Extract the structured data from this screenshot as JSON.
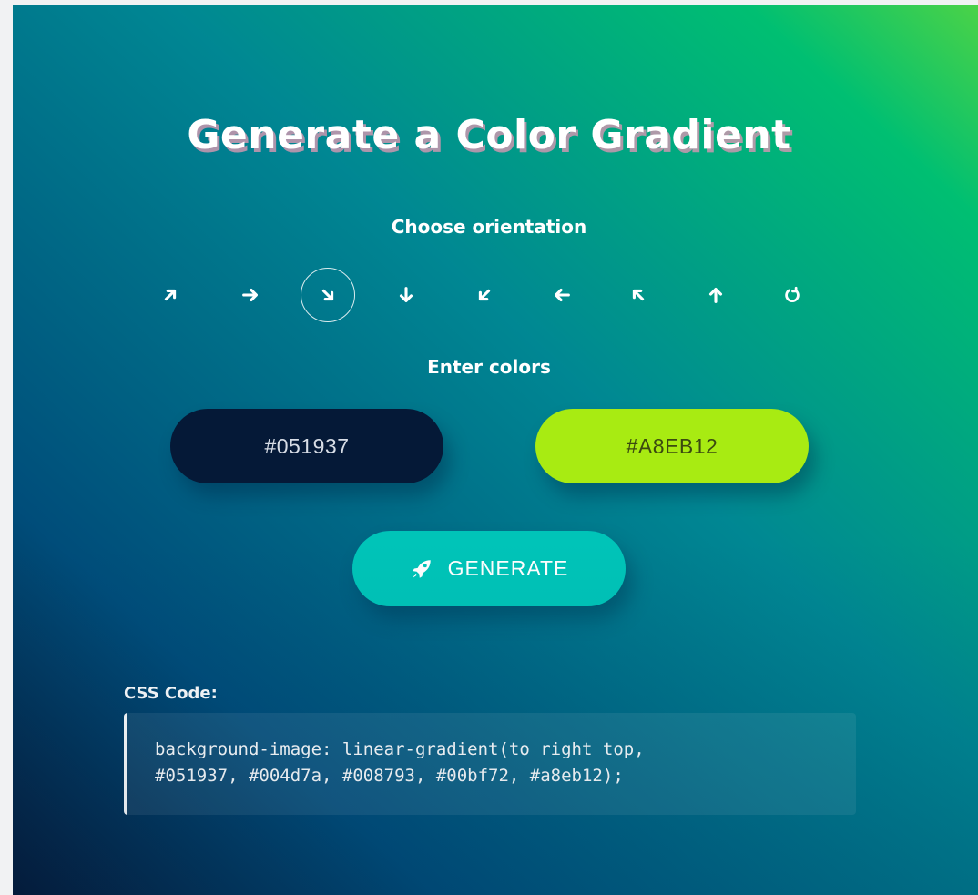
{
  "title": "Generate a Color Gradient",
  "orientation": {
    "label": "Choose orientation",
    "selected": "to-bottom-right",
    "options": [
      {
        "name": "to-top-right",
        "icon": "arrow-up-right-icon"
      },
      {
        "name": "to-right",
        "icon": "arrow-right-icon"
      },
      {
        "name": "to-bottom-right",
        "icon": "arrow-down-right-icon"
      },
      {
        "name": "to-bottom",
        "icon": "arrow-down-icon"
      },
      {
        "name": "to-bottom-left",
        "icon": "arrow-down-left-icon"
      },
      {
        "name": "to-left",
        "icon": "arrow-left-icon"
      },
      {
        "name": "to-top-left",
        "icon": "arrow-up-left-icon"
      },
      {
        "name": "to-top",
        "icon": "arrow-up-icon"
      },
      {
        "name": "radial",
        "icon": "rotate-icon"
      }
    ]
  },
  "colors": {
    "label": "Enter colors",
    "color1": "#051937",
    "color2": "#A8EB12"
  },
  "generate": {
    "label": "GENERATE",
    "icon": "rocket-icon"
  },
  "css_code": {
    "heading": "CSS Code:",
    "line1": "background-image: linear-gradient(to right top,",
    "line2": "#051937, #004d7a, #008793, #00bf72, #a8eb12);"
  },
  "theme": {
    "button_color": "#00c4b8",
    "text_color": "#ffffff"
  }
}
